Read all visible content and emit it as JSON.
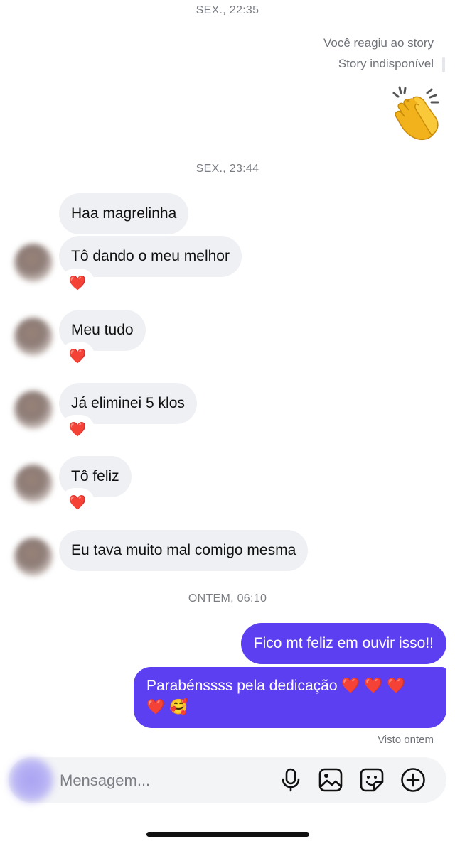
{
  "timestamps": {
    "t1": "SEX., 22:35",
    "t2": "SEX., 23:44",
    "t3": "ONTEM, 06:10"
  },
  "story": {
    "reacted": "Você reagiu ao story",
    "unavailable": "Story indisponível"
  },
  "incoming": [
    {
      "text": "Haa magrelinha",
      "reaction": ""
    },
    {
      "text": "Tô dando o meu melhor",
      "reaction": "❤️"
    },
    {
      "text": "Meu tudo",
      "reaction": "❤️"
    },
    {
      "text": "Já eliminei 5 klos",
      "reaction": "❤️"
    },
    {
      "text": "Tô feliz",
      "reaction": "❤️"
    },
    {
      "text": "Eu tava muito mal comigo mesma",
      "reaction": ""
    }
  ],
  "outgoing": [
    {
      "text": "Fico mt feliz em ouvir isso!!"
    },
    {
      "line1": "Parabénssss pela dedicação ❤️ ❤️ ❤️",
      "line2": "❤️ 🥰"
    }
  ],
  "seen": "Visto ontem",
  "composer": {
    "placeholder": "Mensagem..."
  },
  "icons": [
    "clapping-hands-icon",
    "microphone-icon",
    "gallery-icon",
    "sticker-icon",
    "add-circle-icon"
  ],
  "colors": {
    "outgoing_bubble": "#5b3ff1",
    "incoming_bubble": "#eff0f3",
    "heart": "#e0245e"
  }
}
